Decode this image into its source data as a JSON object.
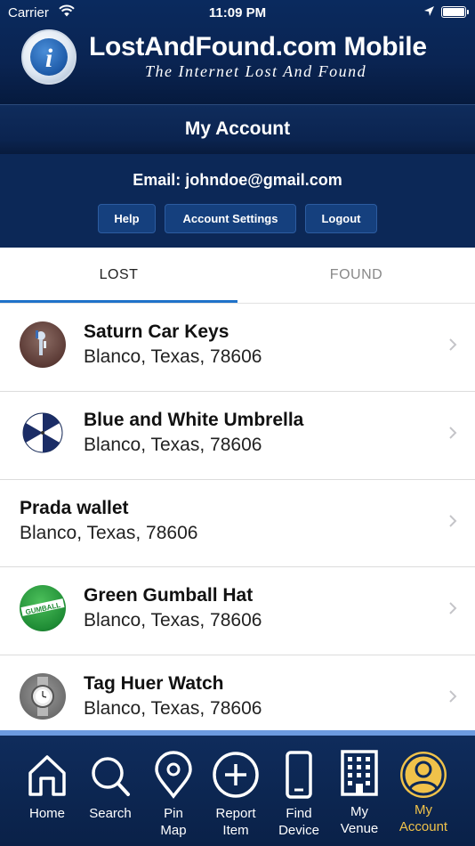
{
  "status_bar": {
    "carrier": "Carrier",
    "time": "11:09 PM"
  },
  "header": {
    "brand_title": "LostAndFound.com Mobile",
    "brand_subtitle": "The Internet Lost And Found",
    "logo_letter": "i"
  },
  "page_title": "My Account",
  "account": {
    "email_text": "Email: johndoe@gmail.com",
    "buttons": {
      "help": "Help",
      "settings": "Account Settings",
      "logout": "Logout"
    }
  },
  "tabs": {
    "lost": "LOST",
    "found": "FOUND",
    "active": "lost"
  },
  "items": [
    {
      "name": "Saturn Car Keys",
      "location": "Blanco, Texas, 78606",
      "thumb": "car-keys-icon"
    },
    {
      "name": "Blue and White Umbrella",
      "location": "Blanco, Texas, 78606",
      "thumb": "umbrella-icon"
    },
    {
      "name": "Prada wallet",
      "location": "Blanco, Texas, 78606",
      "thumb": ""
    },
    {
      "name": "Green Gumball Hat",
      "location": "Blanco, Texas, 78606",
      "thumb": "gumball-hat-icon"
    },
    {
      "name": "Tag Huer Watch",
      "location": "Blanco, Texas, 78606",
      "thumb": "watch-icon"
    }
  ],
  "tab_bar": {
    "home": "Home",
    "search": "Search",
    "pin_map": [
      "Pin",
      "Map"
    ],
    "report_item": [
      "Report",
      "Item"
    ],
    "find_device": [
      "Find",
      "Device"
    ],
    "my_venue": [
      "My",
      "Venue"
    ],
    "my_account": [
      "My",
      "Account"
    ]
  },
  "colors": {
    "navy": "#0c2857",
    "tab_indicator": "#1f72c9",
    "active_tab": "#f0c24a"
  }
}
